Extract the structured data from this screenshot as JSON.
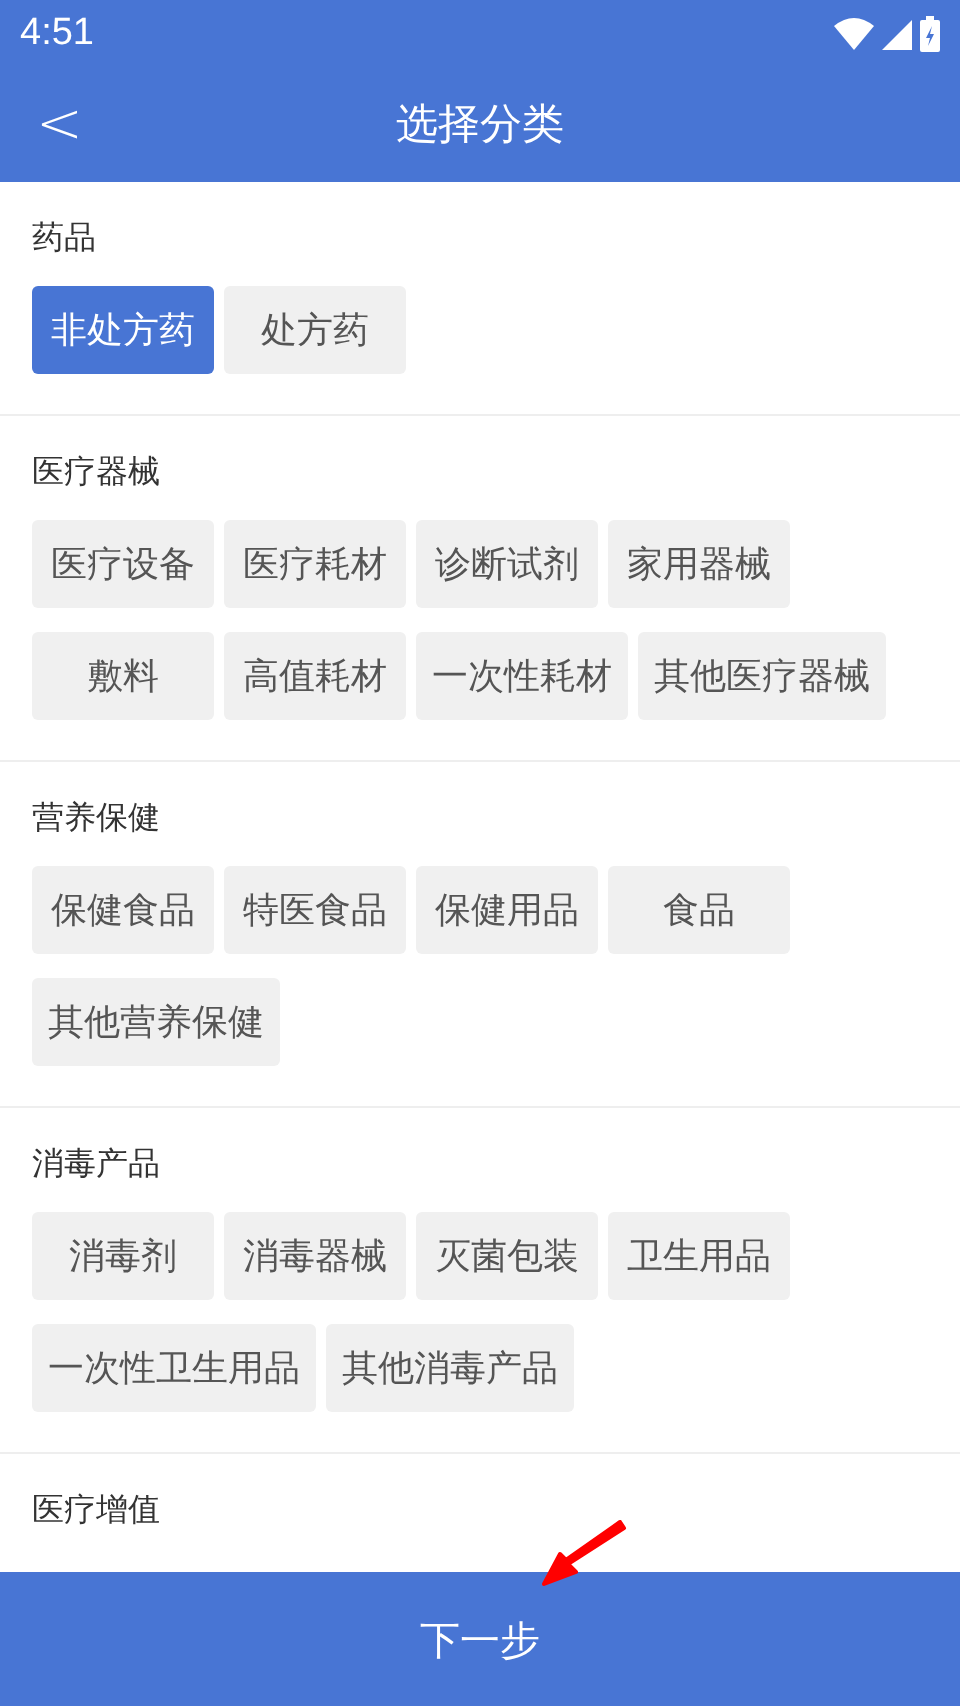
{
  "status_bar": {
    "time": "4:51"
  },
  "header": {
    "back": "<",
    "title": "选择分类"
  },
  "sections": [
    {
      "title": "药品",
      "items": [
        {
          "label": "非处方药",
          "selected": true
        },
        {
          "label": "处方药",
          "selected": false
        }
      ]
    },
    {
      "title": "医疗器械",
      "items": [
        {
          "label": "医疗设备",
          "selected": false
        },
        {
          "label": "医疗耗材",
          "selected": false
        },
        {
          "label": "诊断试剂",
          "selected": false
        },
        {
          "label": "家用器械",
          "selected": false
        },
        {
          "label": "敷料",
          "selected": false
        },
        {
          "label": "高值耗材",
          "selected": false
        },
        {
          "label": "一次性耗材",
          "selected": false
        },
        {
          "label": "其他医疗器械",
          "selected": false
        }
      ]
    },
    {
      "title": "营养保健",
      "items": [
        {
          "label": "保健食品",
          "selected": false
        },
        {
          "label": "特医食品",
          "selected": false
        },
        {
          "label": "保健用品",
          "selected": false
        },
        {
          "label": "食品",
          "selected": false
        },
        {
          "label": "其他营养保健",
          "selected": false
        }
      ]
    },
    {
      "title": "消毒产品",
      "items": [
        {
          "label": "消毒剂",
          "selected": false
        },
        {
          "label": "消毒器械",
          "selected": false
        },
        {
          "label": "灭菌包装",
          "selected": false
        },
        {
          "label": "卫生用品",
          "selected": false
        },
        {
          "label": "一次性卫生用品",
          "selected": false
        },
        {
          "label": "其他消毒产品",
          "selected": false
        }
      ]
    },
    {
      "title": "医疗增值"
    }
  ],
  "next_button": "下一步"
}
